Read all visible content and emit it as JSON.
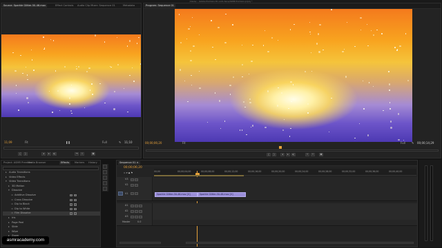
{
  "title_bar": {
    "text": "/Users/... /Adobe Premiere Pro Auto-Save/ASMR Premiere.prproj *"
  },
  "source_monitor": {
    "tabs": [
      "Source: Sparkle Glitter-50-46.mov",
      "Effect Controls",
      "Audio Clip Mixer: Sequence 01",
      "Metadata"
    ],
    "timecode_in": "11;09",
    "timecode_out": "11;10",
    "fit_label": "Fit",
    "full_label": "Full"
  },
  "program_monitor": {
    "tabs": [
      "Program: Sequence 01"
    ],
    "timecode_current": "00;00;06;20",
    "timecode_duration": "00;00;14;29",
    "fit_label": "Fit",
    "full_label": "Full"
  },
  "project_panel": {
    "tabs": [
      "Project: ASMR Premiere",
      "Media Browser",
      "Effects",
      "Markers",
      "History"
    ],
    "search_placeholder": "",
    "tree": [
      {
        "label": "Audio Transitions",
        "indent": 1,
        "type": "folder"
      },
      {
        "label": "Video Effects",
        "indent": 1,
        "type": "folder"
      },
      {
        "label": "Video Transitions",
        "indent": 1,
        "type": "folder-open"
      },
      {
        "label": "3D Motion",
        "indent": 2,
        "type": "folder"
      },
      {
        "label": "Dissolve",
        "indent": 2,
        "type": "folder-open"
      },
      {
        "label": "Additive Dissolve",
        "indent": 3,
        "type": "item"
      },
      {
        "label": "Cross Dissolve",
        "indent": 3,
        "type": "item"
      },
      {
        "label": "Dip to Black",
        "indent": 3,
        "type": "item"
      },
      {
        "label": "Dip to White",
        "indent": 3,
        "type": "item"
      },
      {
        "label": "Film Dissolve",
        "indent": 3,
        "type": "item",
        "selected": true
      },
      {
        "label": "Iris",
        "indent": 2,
        "type": "folder"
      },
      {
        "label": "Page Peel",
        "indent": 2,
        "type": "folder"
      },
      {
        "label": "Slide",
        "indent": 2,
        "type": "folder"
      },
      {
        "label": "Wipe",
        "indent": 2,
        "type": "folder"
      },
      {
        "label": "Zoom",
        "indent": 2,
        "type": "folder"
      }
    ]
  },
  "timeline": {
    "tab": "Sequence 01 ×",
    "timecode": "00;00;06;20",
    "ruler_ticks": [
      "00;00",
      "00;00;04;00",
      "00;00;08;00",
      "00;00;12;00",
      "00;00;16;00",
      "00;00;20;00",
      "00;00;24;00",
      "00;00;28;00",
      "00;00;32;00",
      "00;00;36;00",
      "00;00;40;00"
    ],
    "video_tracks": [
      "V3",
      "V2",
      "V1"
    ],
    "audio_tracks": [
      "A1",
      "A2",
      "A3"
    ],
    "master_label": "Master",
    "master_value": "0.0",
    "clips": [
      {
        "label": "Sparkle Glitter-50-46.mov [V]",
        "track": "V1"
      },
      {
        "label": "Sparkle Glitter-50-46.mov [V]",
        "track": "V1"
      }
    ]
  },
  "watermark": {
    "text": "asmracademy.com"
  },
  "colors": {
    "accent_timecode": "#e8a23a",
    "clip_fill": "#9a8ed8",
    "playhead": "#e8a23a"
  }
}
